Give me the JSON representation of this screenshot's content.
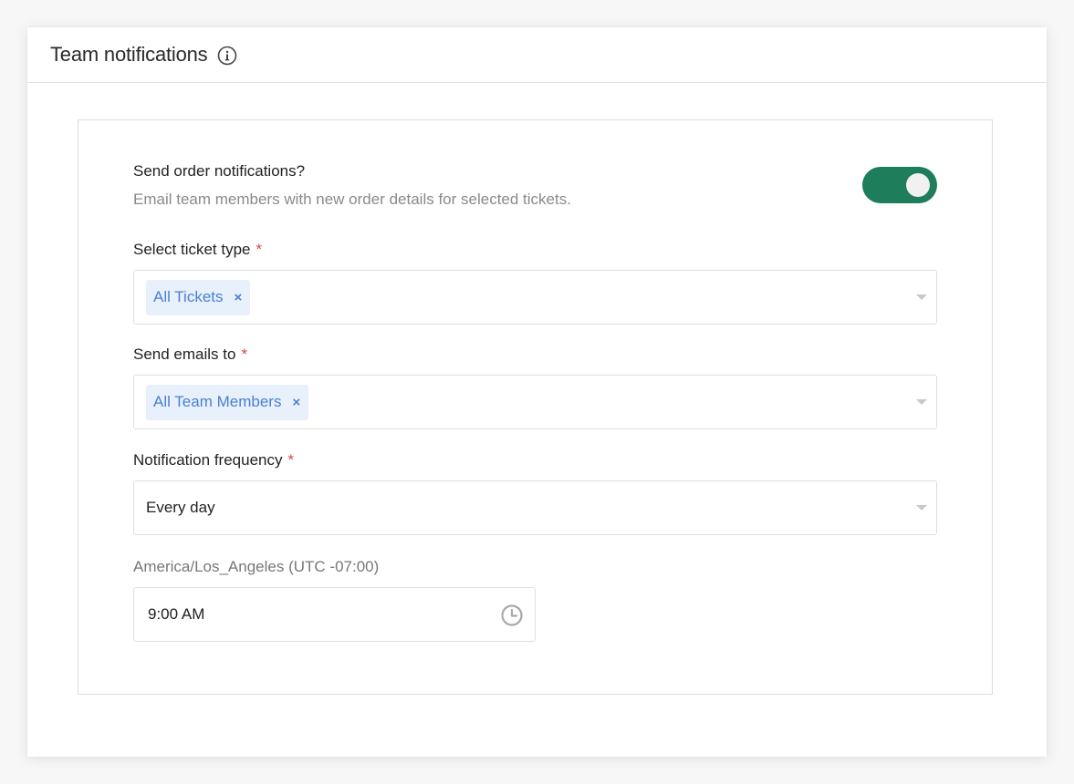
{
  "header": {
    "title": "Team notifications",
    "info_icon": "info-icon"
  },
  "order_notifications": {
    "label": "Send order notifications?",
    "description": "Email team members with new order details for selected tickets.",
    "enabled": true,
    "toggle_color": "#1e7d5b"
  },
  "ticket_type": {
    "label": "Select ticket type",
    "required_mark": "*",
    "selected": [
      "All Tickets"
    ],
    "remove_glyph": "×"
  },
  "send_emails_to": {
    "label": "Send emails to",
    "required_mark": "*",
    "selected": [
      "All Team Members"
    ],
    "remove_glyph": "×"
  },
  "frequency": {
    "label": "Notification frequency",
    "required_mark": "*",
    "value": "Every day"
  },
  "time": {
    "timezone_label": "America/Los_Angeles (UTC -07:00)",
    "value": "9:00 AM",
    "icon": "clock-icon"
  },
  "colors": {
    "chip_bg": "#e8f0fb",
    "chip_text": "#4a7fd4",
    "required": "#d9463e"
  }
}
